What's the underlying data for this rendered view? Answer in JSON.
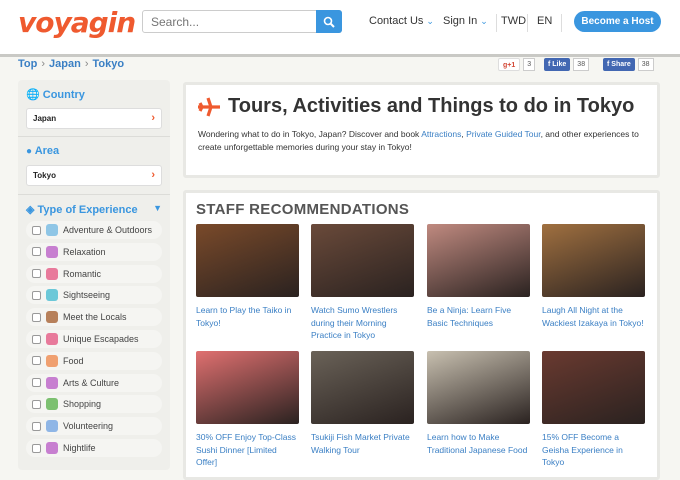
{
  "header": {
    "logo": "voyagin",
    "search_placeholder": "Search...",
    "contact": "Contact Us",
    "signin": "Sign In",
    "currency": "TWD",
    "language": "EN",
    "host_button": "Become a Host"
  },
  "breadcrumb": [
    "Top",
    "Japan",
    "Tokyo"
  ],
  "social": {
    "gplus": "+1",
    "gplus_count": "3",
    "like": "Like",
    "like_count": "38",
    "share": "Share",
    "share_count": "38"
  },
  "sidebar": {
    "country_label": "Country",
    "country_value": "Japan",
    "area_label": "Area",
    "area_value": "Tokyo",
    "type_label": "Type of Experience",
    "types": [
      {
        "label": "Adventure & Outdoors",
        "color": "#8fc6e6"
      },
      {
        "label": "Relaxation",
        "color": "#c77fd0"
      },
      {
        "label": "Romantic",
        "color": "#e87a9b"
      },
      {
        "label": "Sightseeing",
        "color": "#6cc8d8"
      },
      {
        "label": "Meet the Locals",
        "color": "#b7805a"
      },
      {
        "label": "Unique Escapades",
        "color": "#e87a9b"
      },
      {
        "label": "Food",
        "color": "#f0a070"
      },
      {
        "label": "Arts & Culture",
        "color": "#c77fd0"
      },
      {
        "label": "Shopping",
        "color": "#7cc070"
      },
      {
        "label": "Volunteering",
        "color": "#8fb6e6"
      },
      {
        "label": "Nightlife",
        "color": "#c77fd0"
      }
    ]
  },
  "intro": {
    "title": "Tours, Activities and Things to do in Tokyo",
    "text_1": "Wondering what to do in Tokyo, Japan? Discover and book ",
    "link_1": "Attractions",
    "text_2": ", ",
    "link_2": "Private Guided Tour",
    "text_3": ", and other experiences to create unforgettable memories during your stay in Tokyo!"
  },
  "staff": {
    "title": "STAFF RECOMMENDATIONS",
    "cards": [
      {
        "caption": "Learn to Play the Taiko in Tokyo!",
        "color": "#7a4a2a"
      },
      {
        "caption": "Watch Sumo Wrestlers during their Morning Practice in Tokyo",
        "color": "#6a4a3a"
      },
      {
        "caption": "Be a Ninja: Learn Five Basic Techniques",
        "color": "#c08a80"
      },
      {
        "caption": "Laugh All Night at the Wackiest Izakaya in Tokyo!",
        "color": "#a07040"
      },
      {
        "caption": "30% OFF Enjoy Top-Class Sushi Dinner [Limited Offer]",
        "color": "#e07070"
      },
      {
        "caption": "Tsukiji Fish Market Private Walking Tour",
        "color": "#6a6258"
      },
      {
        "caption": "Learn how to Make Traditional Japanese Food",
        "color": "#c8c0b0"
      },
      {
        "caption": "15% OFF Become a Geisha Experience in Tokyo",
        "color": "#6a3a30"
      }
    ]
  }
}
